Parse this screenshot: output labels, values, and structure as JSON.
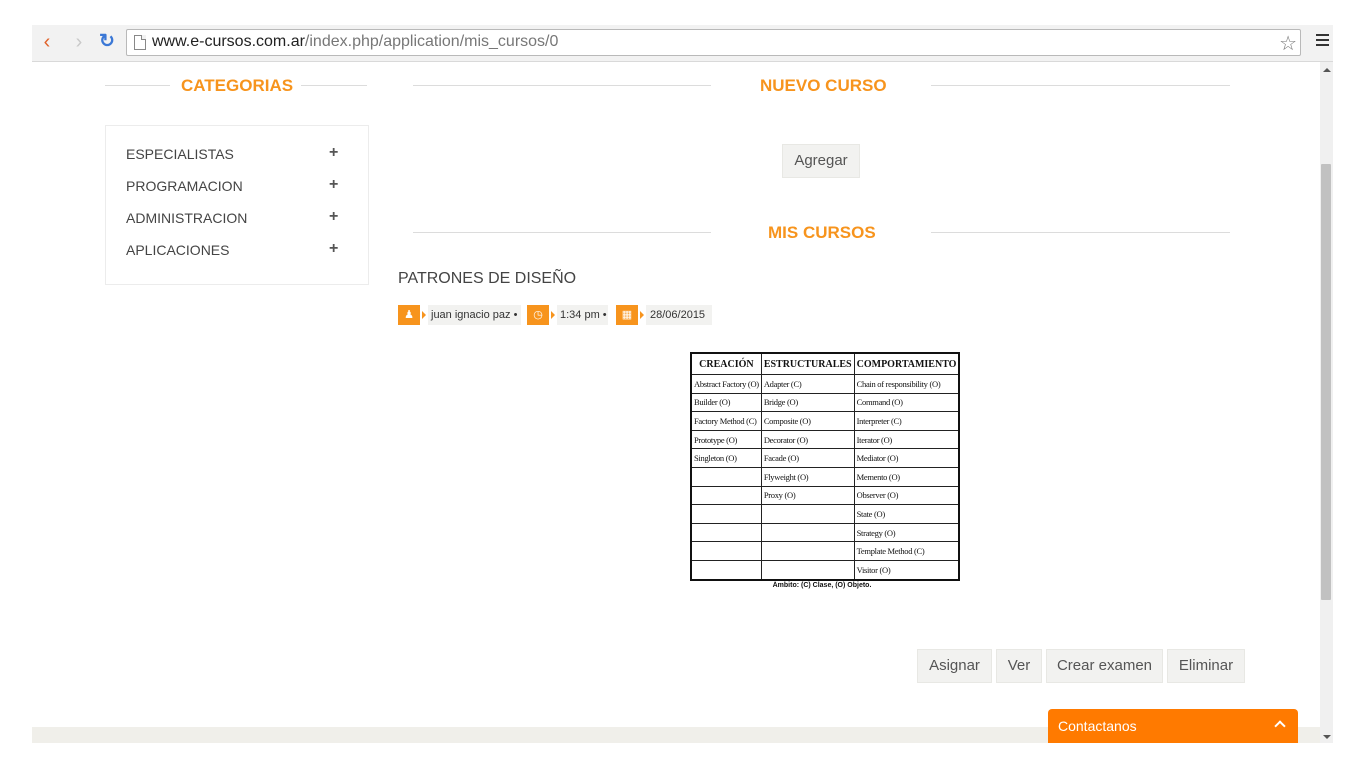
{
  "browser": {
    "url_host": "www.e-cursos.com.ar",
    "url_path": "/index.php/application/mis_cursos/0"
  },
  "sidebar": {
    "title": "CATEGORIAS",
    "items": [
      {
        "label": "ESPECIALISTAS"
      },
      {
        "label": "PROGRAMACION"
      },
      {
        "label": "ADMINISTRACION"
      },
      {
        "label": "APLICACIONES"
      }
    ],
    "expand_glyph": "+"
  },
  "nuevo_curso": {
    "title": "NUEVO CURSO",
    "add_label": "Agregar"
  },
  "mis_cursos": {
    "title": "MIS CURSOS",
    "course": {
      "title": "PATRONES DE DISEÑO",
      "author": "juan ignacio paz",
      "time": "1:34 pm",
      "date": "28/06/2015",
      "actions": {
        "assign": "Asignar",
        "view": "Ver",
        "create_exam": "Crear examen",
        "delete": "Eliminar"
      }
    }
  },
  "pattern_table": {
    "headers": [
      "CREACIÓN",
      "ESTRUCTURALES",
      "COMPORTAMIENTO"
    ],
    "rows": [
      [
        "Abstract Factory (O)",
        "Adapter (C)",
        "Chain of responsibility (O)"
      ],
      [
        "Builder (O)",
        "Bridge (O)",
        "Command (O)"
      ],
      [
        "Factory Method (C)",
        "Composite (O)",
        "Interpreter (C)"
      ],
      [
        "Prototype (O)",
        "Decorator (O)",
        "Iterator (O)"
      ],
      [
        "Singleton (O)",
        "Facade (O)",
        "Mediator (O)"
      ],
      [
        "",
        "Flyweight (O)",
        "Memento (O)"
      ],
      [
        "",
        "Proxy (O)",
        "Observer (O)"
      ],
      [
        "",
        "",
        "State (O)"
      ],
      [
        "",
        "",
        "Strategy (O)"
      ],
      [
        "",
        "",
        "Template Method (C)"
      ],
      [
        "",
        "",
        "Visitor (O)"
      ]
    ],
    "caption": "Ámbito: (C) Clase, (O) Objeto."
  },
  "contact": {
    "label": "Contactanos"
  },
  "colors": {
    "accent": "#f7941d",
    "widget": "#ff7a00"
  }
}
